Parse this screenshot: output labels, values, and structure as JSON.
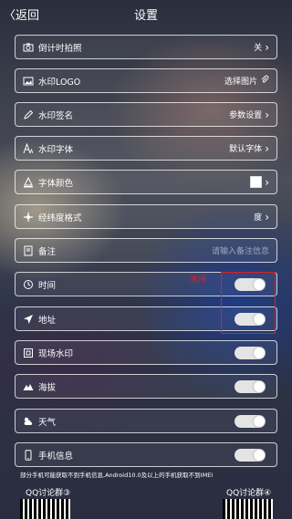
{
  "header": {
    "back_label": "〈返回",
    "title": "设置"
  },
  "rows": [
    {
      "icon": "camera-icon",
      "label": "倒计时拍照",
      "value": "关",
      "type": "chevron"
    },
    {
      "icon": "image-icon",
      "label": "水印LOGO",
      "value": "选择图片",
      "type": "attach"
    },
    {
      "icon": "pen-icon",
      "label": "水印签名",
      "value": "参数设置",
      "type": "chevron"
    },
    {
      "icon": "font-icon",
      "label": "水印字体",
      "value": "默认字体",
      "type": "chevron"
    },
    {
      "icon": "color-icon",
      "label": "字体颜色",
      "value": "",
      "type": "swatch",
      "color": "#ffffff"
    },
    {
      "icon": "coordinates-icon",
      "label": "经纬度格式",
      "value": "度",
      "type": "chevron"
    },
    {
      "icon": "note-icon",
      "label": "备注",
      "placeholder": "请输入备注信息",
      "type": "input"
    },
    {
      "icon": "clock-icon",
      "label": "时间",
      "type": "toggle",
      "on": true
    },
    {
      "icon": "location-icon",
      "label": "地址",
      "type": "toggle",
      "on": true
    },
    {
      "icon": "scene-icon",
      "label": "现场水印",
      "type": "toggle",
      "on": true
    },
    {
      "icon": "mountain-icon",
      "label": "海拔",
      "type": "toggle",
      "on": true
    },
    {
      "icon": "weather-icon",
      "label": "天气",
      "type": "toggle",
      "on": true
    },
    {
      "icon": "phone-icon",
      "label": "手机信息",
      "type": "toggle",
      "on": true
    }
  ],
  "annotation": {
    "label": "关闭",
    "color": "#e02020"
  },
  "note": "部分手机可能获取不到手机信息,Android10.0及以上的手机获取不到IMEI",
  "qq_groups": {
    "left": "QQ讨论群③",
    "right": "QQ讨论群④"
  }
}
